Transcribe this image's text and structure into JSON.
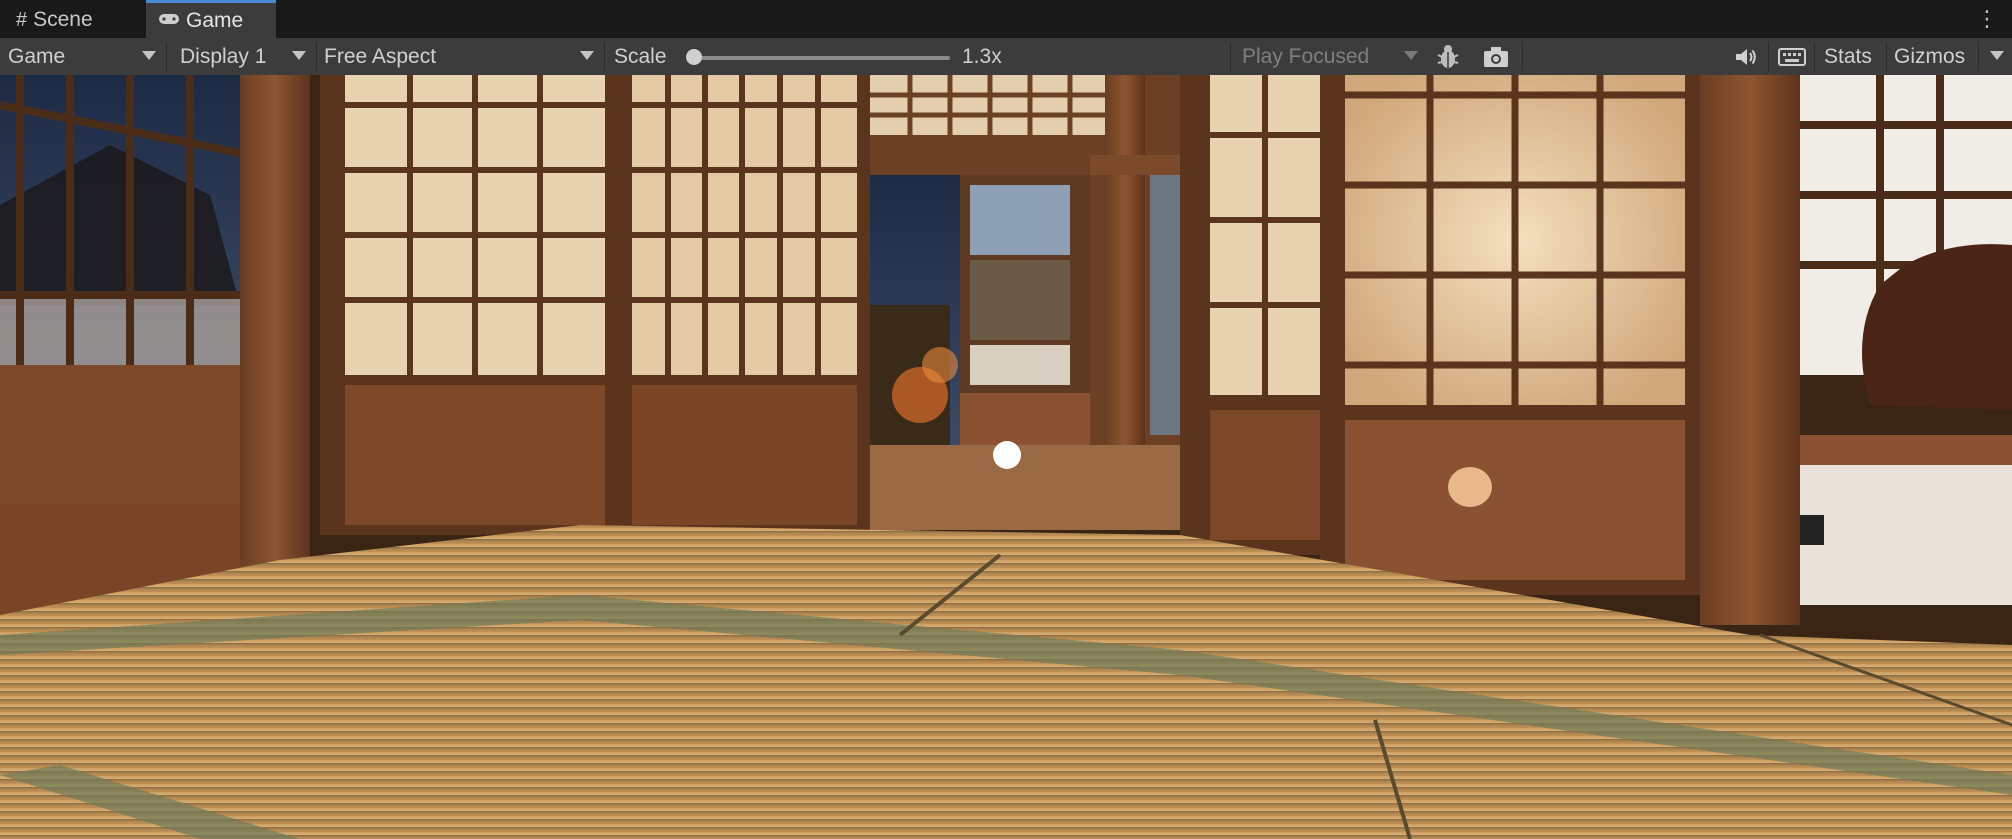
{
  "tabs": {
    "scene": {
      "label": "Scene",
      "icon": "grid-hash-icon"
    },
    "game": {
      "label": "Game",
      "icon": "gamepad-icon"
    }
  },
  "toolbar": {
    "view_mode": "Game",
    "display": "Display 1",
    "aspect": "Free Aspect",
    "scale_label": "Scale",
    "scale_value": "1.3x",
    "scale_fraction": 0.0,
    "play_mode": "Play Focused",
    "stats_label": "Stats",
    "gizmos_label": "Gizmos",
    "icons": [
      "bug-icon",
      "camera-icon",
      "speaker-icon",
      "keyboard-icon"
    ]
  },
  "colors": {
    "accent": "#4a8bd6",
    "toolbar_bg": "#3c3c3c",
    "tabbar_bg": "#191919"
  }
}
